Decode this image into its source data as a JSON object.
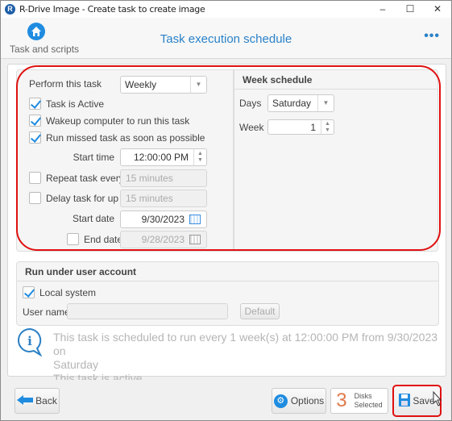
{
  "window": {
    "title": "R-Drive Image - Create task to create image",
    "controls": {
      "minimize": "–",
      "maximize": "☐",
      "close": "✕"
    }
  },
  "header": {
    "home_label": "Task and scripts",
    "title": "Task execution schedule",
    "more_label": "•••"
  },
  "schedule": {
    "perform_label": "Perform this task",
    "perform_value": "Weekly",
    "task_active": {
      "label": "Task is Active",
      "checked": true
    },
    "wakeup": {
      "label": "Wakeup computer to run this task",
      "checked": true
    },
    "run_missed": {
      "label": "Run missed task as soon as possible",
      "checked": true
    },
    "start_time_label": "Start time",
    "start_time_value": "12:00:00 PM",
    "repeat": {
      "label": "Repeat task every",
      "checked": false,
      "value": "15 minutes"
    },
    "delay": {
      "label": "Delay task for up to",
      "checked": false,
      "value": "15 minutes"
    },
    "start_date_label": "Start date",
    "start_date_value": "9/30/2023",
    "end_date": {
      "label": "End date",
      "checked": false,
      "value": "9/28/2023"
    }
  },
  "week_schedule": {
    "title": "Week schedule",
    "days_label": "Days",
    "days_value": "Saturday",
    "week_label": "Week",
    "week_value": "1"
  },
  "account": {
    "title": "Run under user account",
    "local_system": {
      "label": "Local system",
      "checked": true
    },
    "username_label": "User name",
    "username_value": "",
    "default_button": "Default"
  },
  "info": {
    "line1": "This task is scheduled to run every 1 week(s) at 12:00:00 PM from 9/30/2023 on",
    "line2": "Saturday",
    "line3": "This task is active"
  },
  "footer": {
    "back_label": "Back",
    "options_label": "Options",
    "disks_count": "3",
    "disks_label_1": "Disks",
    "disks_label_2": "Selected",
    "save_label": "Save"
  },
  "colors": {
    "accent": "#2a82c9",
    "highlight": "#e01010",
    "disk_count": "#e07a4a"
  }
}
